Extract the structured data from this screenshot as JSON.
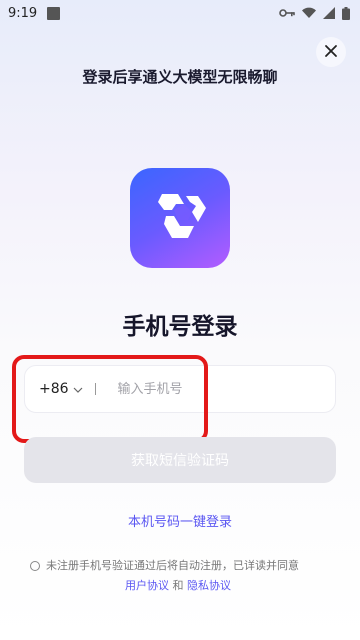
{
  "status_bar": {
    "time": "9:19",
    "icons": [
      "app-notification-icon",
      "vpn-key-icon",
      "wifi-icon",
      "signal-icon",
      "battery-icon"
    ]
  },
  "header": {
    "close_icon": "close-icon",
    "headline": "登录后享通义大模型无限畅聊"
  },
  "app": {
    "logo_icon": "tongyi-logo-icon",
    "colors": {
      "gradient_start": "#3a66ff",
      "gradient_end": "#b35cff"
    }
  },
  "login": {
    "title": "手机号登录",
    "country_code": "+86",
    "dropdown_icon": "chevron-down-icon",
    "phone_placeholder": "输入手机号",
    "phone_value": "",
    "sms_button": "获取短信验证码",
    "one_click": "本机号码一键登录"
  },
  "agreement": {
    "text": "未注册手机号验证通过后将自动注册，已详读并同意",
    "user_agreement": "用户协议",
    "and": "和",
    "privacy_policy": "隐私协议"
  },
  "colors": {
    "accent": "#5b57f2",
    "annotation_red": "#e31919",
    "disabled_button": "#e4e4ea"
  }
}
